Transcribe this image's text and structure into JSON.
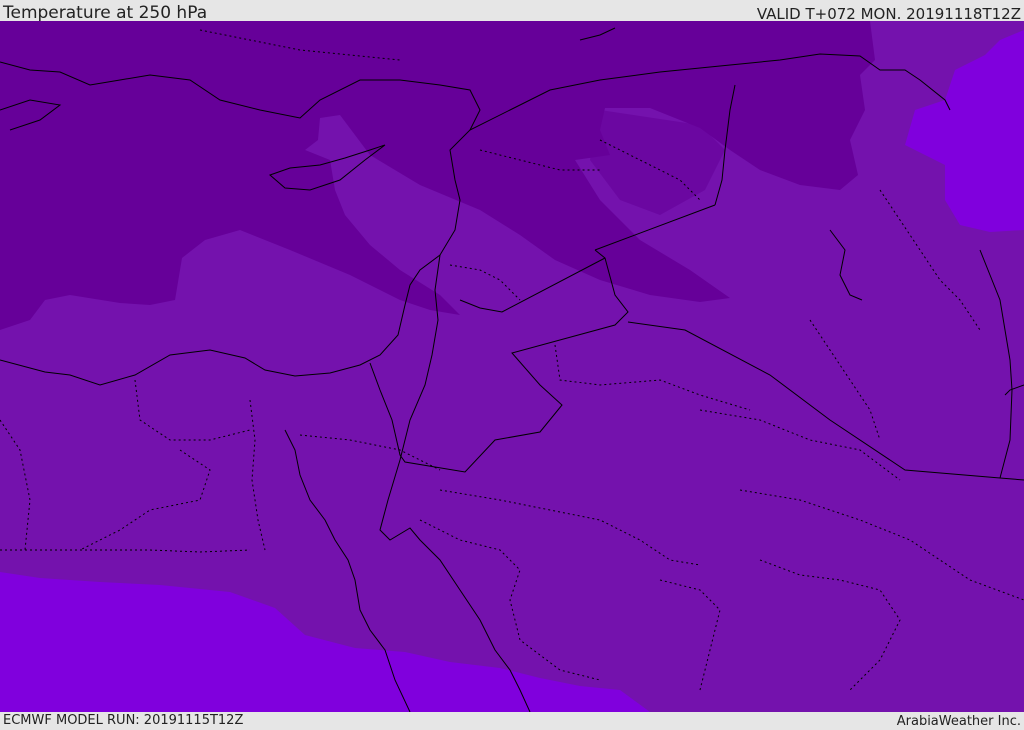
{
  "header": {
    "title": "Temperature at 250 hPa",
    "valid_time": "VALID T+072 MON. 20191118T12Z"
  },
  "footer": {
    "model_run": "ECMWF MODEL RUN: 20191115T12Z",
    "credit": "ArabiaWeather Inc."
  },
  "map": {
    "field": "temperature",
    "pressure_level": "250 hPa",
    "shading_colors": {
      "coldest": "#660099",
      "cold": "#7412ad",
      "warm": "#8000dd"
    },
    "border_color": "#000000",
    "coastline_color": "#000000"
  }
}
